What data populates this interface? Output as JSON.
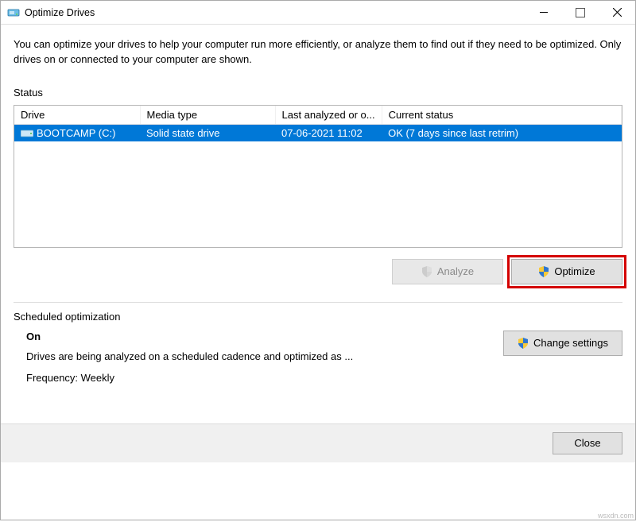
{
  "title": "Optimize Drives",
  "intro": "You can optimize your drives to help your computer run more efficiently, or analyze them to find out if they need to be optimized. Only drives on or connected to your computer are shown.",
  "status_label": "Status",
  "columns": {
    "drive": "Drive",
    "media": "Media type",
    "last": "Last analyzed or o...",
    "status": "Current status"
  },
  "row": {
    "drive": "BOOTCAMP (C:)",
    "media": "Solid state drive",
    "last": "07-06-2021 11:02",
    "status": "OK (7 days since last retrim)"
  },
  "buttons": {
    "analyze": "Analyze",
    "optimize": "Optimize",
    "change": "Change settings",
    "close": "Close"
  },
  "schedule": {
    "title": "Scheduled optimization",
    "state": "On",
    "desc": "Drives are being analyzed on a scheduled cadence and optimized as ...",
    "freq": "Frequency: Weekly"
  },
  "watermark": "wsxdn.com"
}
